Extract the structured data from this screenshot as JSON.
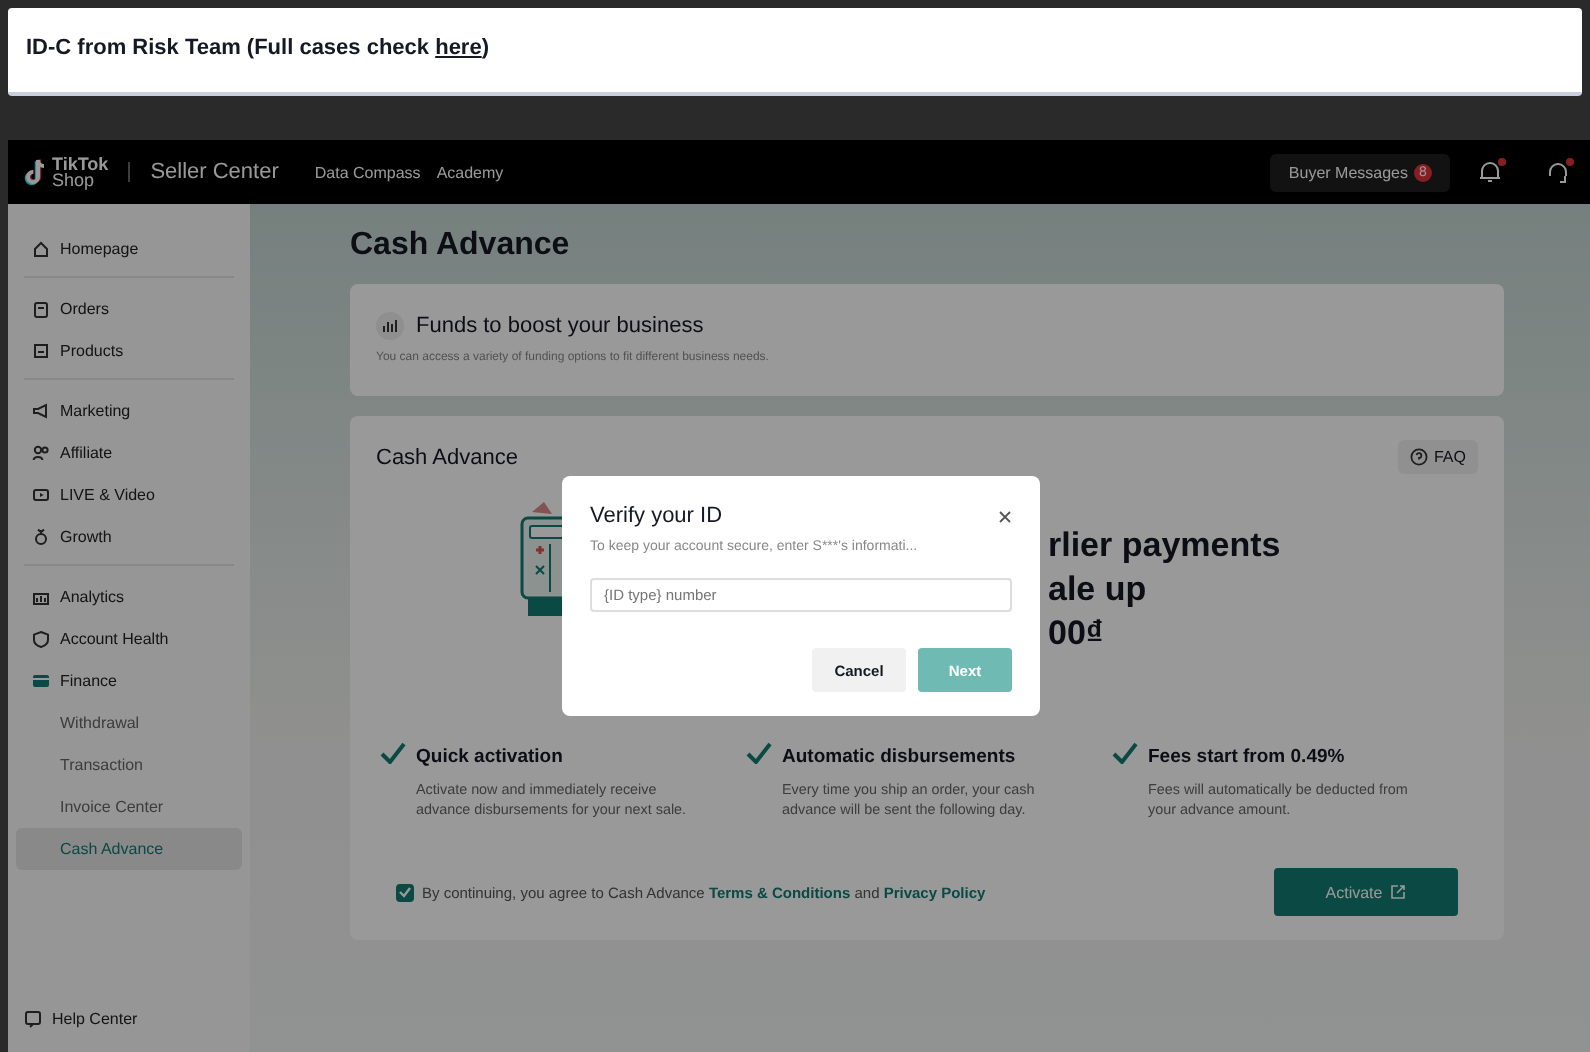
{
  "banner": {
    "title": "ID-C from Risk Team (Full cases check ",
    "link": "here",
    "closing": ")"
  },
  "header": {
    "logo_top": "TikTok",
    "logo_bottom": "Shop",
    "product": "Seller Center",
    "nav": [
      "Data Compass",
      "Academy"
    ],
    "messages_label": "Buyer Messages",
    "messages_count": "8"
  },
  "sidebar": {
    "groups": [
      [
        {
          "label": "Homepage",
          "selected": false
        }
      ],
      [
        {
          "label": "Orders",
          "selected": false
        },
        {
          "label": "Products",
          "selected": false
        }
      ],
      [
        {
          "label": "Marketing",
          "selected": false
        },
        {
          "label": "Affiliate",
          "selected": false
        },
        {
          "label": "LIVE & Video",
          "selected": false
        },
        {
          "label": "Growth",
          "selected": false
        }
      ],
      [
        {
          "label": "Analytics",
          "selected": false
        },
        {
          "label": "Account Health",
          "selected": false
        },
        {
          "label": "Finance",
          "selected": false,
          "children": [
            {
              "label": "Withdrawal",
              "selected": false
            },
            {
              "label": "Transaction",
              "selected": false
            },
            {
              "label": "Invoice Center",
              "selected": false
            },
            {
              "label": "Cash Advance",
              "selected": true
            }
          ]
        }
      ]
    ],
    "footer_item": "Help Center"
  },
  "page_title": "Cash Advance",
  "funds_card": {
    "title": "Funds to boost your business",
    "subtitle": "You can access a variety of funding options to fit different business needs."
  },
  "cash_card": {
    "title": "Cash Advance",
    "faq": "FAQ",
    "hero_lines": [
      "rlier payments",
      "ale up",
      "00₫"
    ],
    "features": [
      {
        "title": "Quick activation",
        "text": "Activate now and immediately receive advance disbursements for your next sale."
      },
      {
        "title": "Automatic disbursements",
        "text": "Every time you ship an order, your cash advance will be sent the following day."
      },
      {
        "title": "Fees start from 0.49%",
        "text": "Fees will automatically be deducted from your advance amount."
      }
    ],
    "agreement": {
      "checked": true,
      "text": "By continuing, you agree to Cash Advance ",
      "terms": "Terms & Conditions",
      "and": " and ",
      "privacy": "Privacy Policy"
    },
    "activate": "Activate"
  },
  "modal": {
    "title": "Verify your ID",
    "subtitle": "To keep your account secure, enter S***'s informati...",
    "placeholder": "{ID type} number",
    "cancel": "Cancel",
    "next": "Next",
    "next_disabled": true
  }
}
